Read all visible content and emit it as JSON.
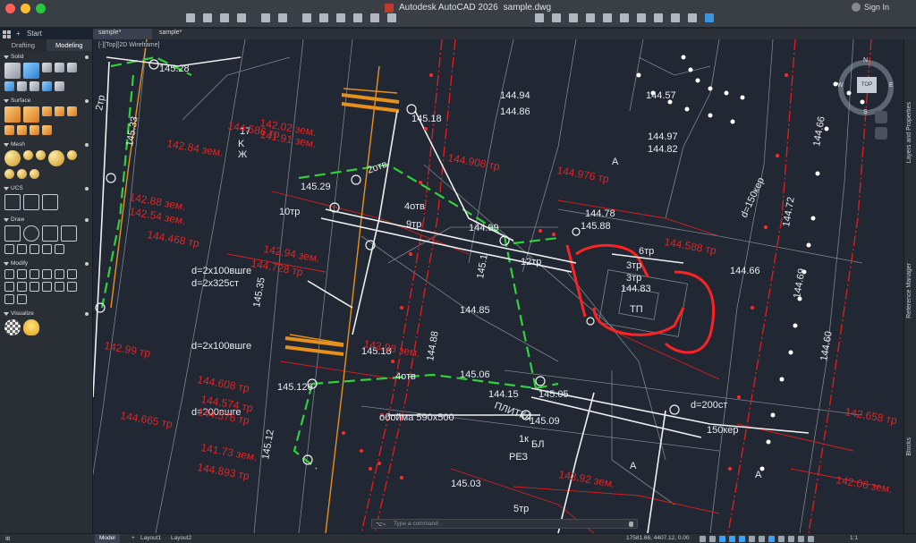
{
  "window": {
    "title": "Autodesk AutoCAD 2026",
    "filename": "sample.dwg",
    "signin": "Sign In"
  },
  "tabs": {
    "start": "Start",
    "documents": [
      {
        "label": "sample*"
      },
      {
        "label": "sample*"
      }
    ]
  },
  "palette": {
    "tabs": [
      {
        "label": "Drafting"
      },
      {
        "label": "Modeling"
      }
    ],
    "sections": [
      {
        "title": "Solid"
      },
      {
        "title": "Surface"
      },
      {
        "title": "Mesh"
      },
      {
        "title": "UCS"
      },
      {
        "title": "Draw"
      },
      {
        "title": "Modify"
      },
      {
        "title": "Visualize"
      }
    ]
  },
  "viewport": {
    "label": "[-][Top][2D Wireframe]"
  },
  "viewcube": {
    "top": "TOP",
    "north": "N",
    "west": "W",
    "east": "E",
    "south": "S"
  },
  "right_palettes": {
    "layers": "Layers and Properties",
    "reference": "Reference Manager",
    "blocks": "Blocks"
  },
  "command": {
    "prompt": "⌥~",
    "placeholder": "Type a command"
  },
  "statusbar": {
    "layouts": [
      {
        "label": "Model"
      },
      {
        "label": "Layout1"
      },
      {
        "label": "Layout2"
      }
    ],
    "coords": "17581.66, 4407.12, 0.00",
    "scale": "1:1"
  },
  "drawing": {
    "labels_white": [
      "145.28",
      "144.86",
      "144.94",
      "144.57",
      "144.97",
      "144.82",
      "145.33",
      "145.18",
      "145.29",
      "144.99",
      "145.1",
      "144.85",
      "144.78",
      "145.88",
      "144.83",
      "145.06",
      "145.09",
      "144.66",
      "144.69",
      "145.05",
      "145.03",
      "144.88",
      "145.126",
      "145.12",
      "145.35",
      "145.18",
      "144.15",
      "144.72",
      "144.60",
      "144.66",
      "2тр",
      "10тр",
      "6тр",
      "3тр",
      "4отв",
      "9тр",
      "2отв",
      "12тр",
      "4отв",
      "d=150кер",
      "d=200ст",
      "150кер",
      "d=2x100вшге",
      "d=2x325ст",
      "d=2x100вшге",
      "d=200вшге",
      "обойма 590x500",
      "ПЛИТКА",
      "ТП",
      "РЕЗ",
      "БЛ",
      "1к",
      "5тр",
      "3тр",
      "K",
      "A",
      "A",
      "A",
      "Ж",
      "17"
    ],
    "labels_red": [
      "142.84 зем.",
      "144.586 тр",
      "142.02 зем.",
      "141.91 зем.",
      "144.976 тр",
      "144.588 тр",
      "142.94 зем.",
      "144.728 тр",
      "142.99 тр",
      "144.665 тр",
      "144.574 тр",
      "144.608 тр",
      "144.576 тр",
      "144.893 тр",
      "142.658 тр",
      "142.06 зем.",
      "141.73 зем.",
      "143.98 зем.",
      "144.468 тр",
      "144.908 тр",
      "143.92 зем.",
      "142.88 зем.",
      "142.54 зем."
    ]
  },
  "colors": {
    "canvas": "#212833",
    "accent": "#3ba2ff",
    "red_lines": "#d81e1e",
    "green_lines": "#30d13a",
    "orange_lines": "#e8901c"
  }
}
